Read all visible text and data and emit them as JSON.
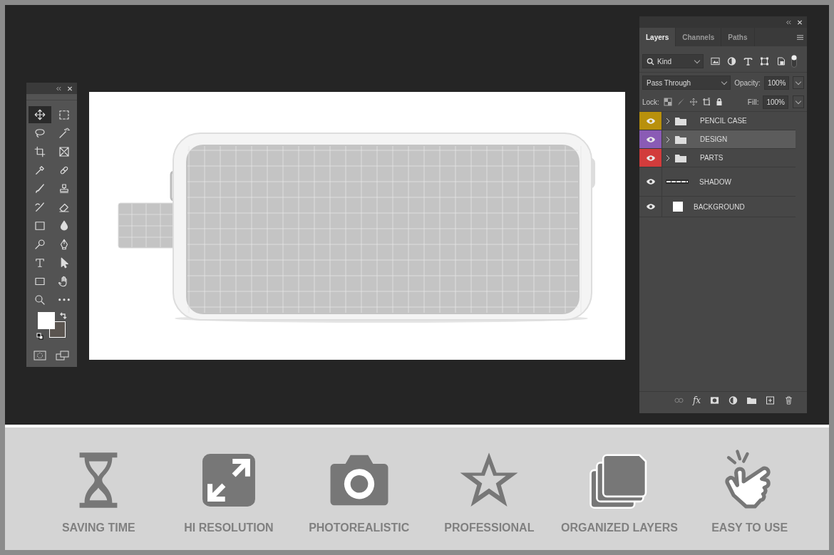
{
  "toolbar": {
    "tools": [
      {
        "kind": "move",
        "selected": true
      },
      {
        "kind": "marquee",
        "selected": false
      },
      {
        "kind": "lasso",
        "selected": false
      },
      {
        "kind": "magic-wand",
        "selected": false
      },
      {
        "kind": "crop",
        "selected": false
      },
      {
        "kind": "frame",
        "selected": false
      },
      {
        "kind": "eyedropper",
        "selected": false
      },
      {
        "kind": "healing",
        "selected": false
      },
      {
        "kind": "brush",
        "selected": false
      },
      {
        "kind": "stamp",
        "selected": false
      },
      {
        "kind": "history-brush",
        "selected": false
      },
      {
        "kind": "eraser",
        "selected": false
      },
      {
        "kind": "gradient",
        "selected": false
      },
      {
        "kind": "drop",
        "selected": false
      },
      {
        "kind": "dodge",
        "selected": false
      },
      {
        "kind": "pen",
        "selected": false
      },
      {
        "kind": "type",
        "selected": false
      },
      {
        "kind": "arrow",
        "selected": false
      },
      {
        "kind": "rectangle",
        "selected": false
      },
      {
        "kind": "hand",
        "selected": false
      },
      {
        "kind": "zoom",
        "selected": false
      },
      {
        "kind": "more",
        "selected": false
      }
    ]
  },
  "layers_panel": {
    "tabs": [
      {
        "label": "Layers",
        "selected": true
      },
      {
        "label": "Channels",
        "selected": false
      },
      {
        "label": "Paths",
        "selected": false
      }
    ],
    "filter": "Kind",
    "blend_mode": "Pass Through",
    "opacity_label": "Opacity:",
    "opacity": "100%",
    "lock_label": "Lock:",
    "fill_label": "Fill:",
    "fill": "100%",
    "layers": [
      {
        "name": "PENCIL CASE",
        "kind": "group",
        "color": "#b8900c",
        "selected": false,
        "visible": true
      },
      {
        "name": "DESIGN",
        "kind": "group",
        "color": "#8a5bb5",
        "selected": true,
        "visible": true
      },
      {
        "name": "PARTS",
        "kind": "group",
        "color": "#d23c3c",
        "selected": false,
        "visible": true
      },
      {
        "name": "SHADOW",
        "kind": "shadow",
        "selected": false,
        "visible": true
      },
      {
        "name": "BACKGROUND",
        "kind": "fill",
        "selected": false,
        "visible": true
      }
    ],
    "footer_fx": "fx"
  },
  "features": [
    {
      "kind": "hourglass",
      "label": "SAVING TIME"
    },
    {
      "kind": "expand",
      "label": "HI RESOLUTION"
    },
    {
      "kind": "camera",
      "label": "PHOTOREALISTIC"
    },
    {
      "kind": "star",
      "label": "PROFESSIONAL"
    },
    {
      "kind": "folders",
      "label": "ORGANIZED LAYERS"
    },
    {
      "kind": "hand",
      "label": "EASY TO USE"
    }
  ]
}
